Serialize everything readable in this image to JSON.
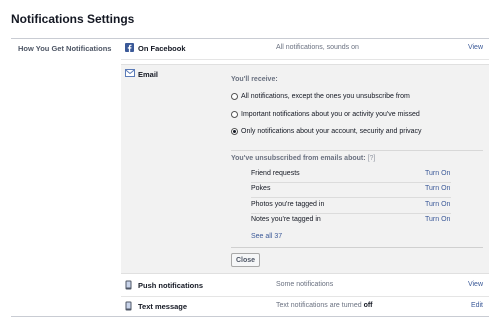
{
  "page": {
    "title": "Notifications Settings"
  },
  "section": {
    "label": "How You Get Notifications"
  },
  "colors": {
    "link": "#3b5998",
    "facebook_blue": "#3b5998",
    "panel_bg": "#f2f2f2"
  },
  "rows": {
    "facebook": {
      "icon": "facebook-icon",
      "title": "On Facebook",
      "summary": "All notifications, sounds on",
      "action": "View"
    },
    "email": {
      "icon": "envelope-icon",
      "title": "Email",
      "receive_label": "You'll receive:",
      "options": [
        {
          "label": "All notifications, except the ones you unsubscribe from",
          "checked": false
        },
        {
          "label": "Important notifications about you or activity you've missed",
          "checked": false
        },
        {
          "label": "Only notifications about your account, security and privacy",
          "checked": true
        }
      ],
      "unsub_label": "You've unsubscribed from emails about:",
      "unsub_help": "[?]",
      "unsubscribed": [
        {
          "name": "Friend requests",
          "action": "Turn On"
        },
        {
          "name": "Pokes",
          "action": "Turn On"
        },
        {
          "name": "Photos you're tagged in",
          "action": "Turn On"
        },
        {
          "name": "Notes you're tagged in",
          "action": "Turn On"
        }
      ],
      "see_all": "See all 37",
      "close_label": "Close"
    },
    "push": {
      "icon": "mobile-phone-icon",
      "title": "Push notifications",
      "summary": "Some notifications",
      "action": "View"
    },
    "text": {
      "icon": "mobile-phone-icon",
      "title": "Text message",
      "summary_prefix": "Text notifications are turned ",
      "summary_state": "off",
      "action": "Edit"
    }
  }
}
